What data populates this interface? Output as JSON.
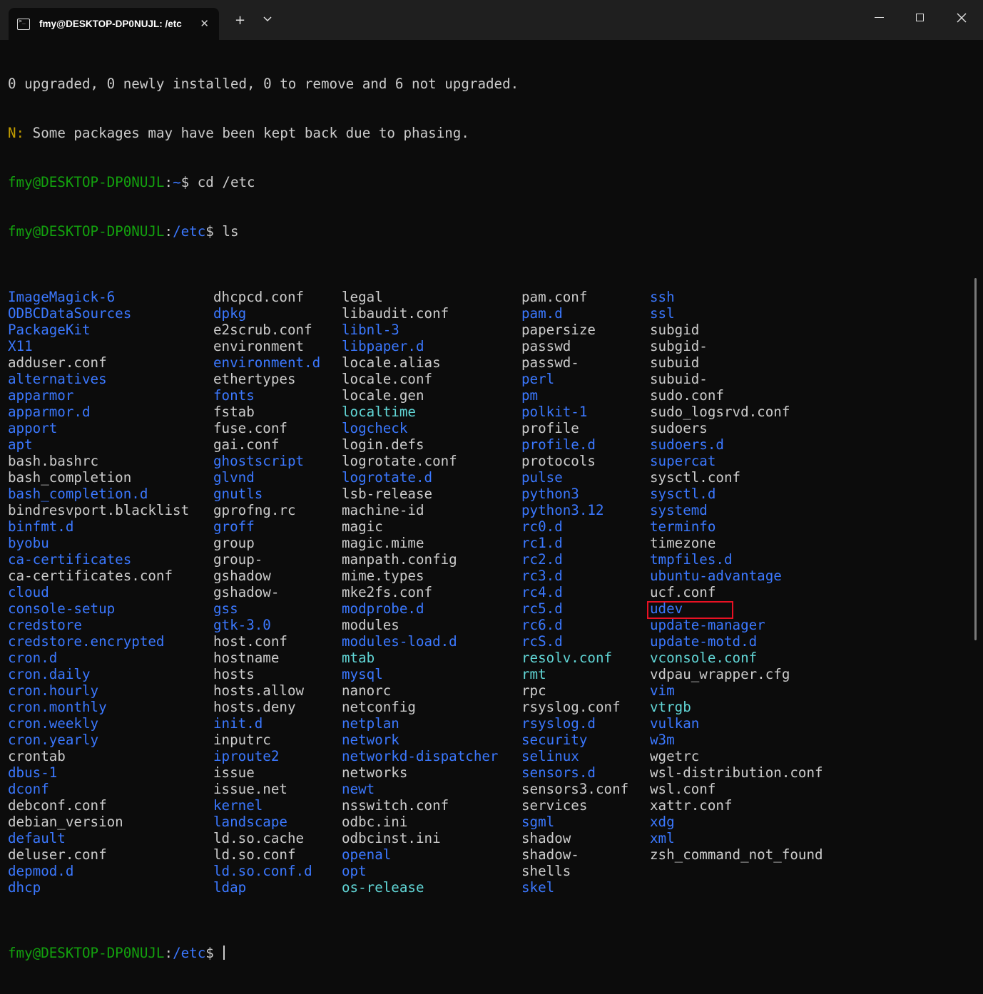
{
  "window": {
    "tab_title": "fmy@DESKTOP-DP0NUJL: /etc",
    "new_tab_label": "+"
  },
  "terminal": {
    "output_lines": [
      "0 upgraded, 0 newly installed, 0 to remove and 6 not upgraded."
    ],
    "notice": {
      "prefix": "N:",
      "text": " Some packages may have been kept back due to phasing."
    },
    "commands": [
      {
        "user": "fmy@DESKTOP-DP0NUJL",
        "sep": ":",
        "path": "~",
        "dollar": "$",
        "cmd": " cd /etc"
      },
      {
        "user": "fmy@DESKTOP-DP0NUJL",
        "sep": ":",
        "path": "/etc",
        "dollar": "$",
        "cmd": " ls"
      }
    ],
    "final_prompt": {
      "user": "fmy@DESKTOP-DP0NUJL",
      "sep": ":",
      "path": "/etc",
      "dollar": "$",
      "cmd": " "
    },
    "ls_columns": [
      [
        {
          "n": "ImageMagick-6",
          "t": "dir"
        },
        {
          "n": "ODBCDataSources",
          "t": "dir"
        },
        {
          "n": "PackageKit",
          "t": "dir"
        },
        {
          "n": "X11",
          "t": "dir"
        },
        {
          "n": "adduser.conf",
          "t": "file"
        },
        {
          "n": "alternatives",
          "t": "dir"
        },
        {
          "n": "apparmor",
          "t": "dir"
        },
        {
          "n": "apparmor.d",
          "t": "dir"
        },
        {
          "n": "apport",
          "t": "dir"
        },
        {
          "n": "apt",
          "t": "dir"
        },
        {
          "n": "bash.bashrc",
          "t": "file"
        },
        {
          "n": "bash_completion",
          "t": "file"
        },
        {
          "n": "bash_completion.d",
          "t": "dir"
        },
        {
          "n": "bindresvport.blacklist",
          "t": "file"
        },
        {
          "n": "binfmt.d",
          "t": "dir"
        },
        {
          "n": "byobu",
          "t": "dir"
        },
        {
          "n": "ca-certificates",
          "t": "dir"
        },
        {
          "n": "ca-certificates.conf",
          "t": "file"
        },
        {
          "n": "cloud",
          "t": "dir"
        },
        {
          "n": "console-setup",
          "t": "dir"
        },
        {
          "n": "credstore",
          "t": "dir"
        },
        {
          "n": "credstore.encrypted",
          "t": "dir"
        },
        {
          "n": "cron.d",
          "t": "dir"
        },
        {
          "n": "cron.daily",
          "t": "dir"
        },
        {
          "n": "cron.hourly",
          "t": "dir"
        },
        {
          "n": "cron.monthly",
          "t": "dir"
        },
        {
          "n": "cron.weekly",
          "t": "dir"
        },
        {
          "n": "cron.yearly",
          "t": "dir"
        },
        {
          "n": "crontab",
          "t": "file"
        },
        {
          "n": "dbus-1",
          "t": "dir"
        },
        {
          "n": "dconf",
          "t": "dir"
        },
        {
          "n": "debconf.conf",
          "t": "file"
        },
        {
          "n": "debian_version",
          "t": "file"
        },
        {
          "n": "default",
          "t": "dir"
        },
        {
          "n": "deluser.conf",
          "t": "file"
        },
        {
          "n": "depmod.d",
          "t": "dir"
        },
        {
          "n": "dhcp",
          "t": "dir"
        }
      ],
      [
        {
          "n": "dhcpcd.conf",
          "t": "file"
        },
        {
          "n": "dpkg",
          "t": "dir"
        },
        {
          "n": "e2scrub.conf",
          "t": "file"
        },
        {
          "n": "environment",
          "t": "file"
        },
        {
          "n": "environment.d",
          "t": "dir"
        },
        {
          "n": "ethertypes",
          "t": "file"
        },
        {
          "n": "fonts",
          "t": "dir"
        },
        {
          "n": "fstab",
          "t": "file"
        },
        {
          "n": "fuse.conf",
          "t": "file"
        },
        {
          "n": "gai.conf",
          "t": "file"
        },
        {
          "n": "ghostscript",
          "t": "dir"
        },
        {
          "n": "glvnd",
          "t": "dir"
        },
        {
          "n": "gnutls",
          "t": "dir"
        },
        {
          "n": "gprofng.rc",
          "t": "file"
        },
        {
          "n": "groff",
          "t": "dir"
        },
        {
          "n": "group",
          "t": "file"
        },
        {
          "n": "group-",
          "t": "file"
        },
        {
          "n": "gshadow",
          "t": "file"
        },
        {
          "n": "gshadow-",
          "t": "file"
        },
        {
          "n": "gss",
          "t": "dir"
        },
        {
          "n": "gtk-3.0",
          "t": "dir"
        },
        {
          "n": "host.conf",
          "t": "file"
        },
        {
          "n": "hostname",
          "t": "file"
        },
        {
          "n": "hosts",
          "t": "file"
        },
        {
          "n": "hosts.allow",
          "t": "file"
        },
        {
          "n": "hosts.deny",
          "t": "file"
        },
        {
          "n": "init.d",
          "t": "dir"
        },
        {
          "n": "inputrc",
          "t": "file"
        },
        {
          "n": "iproute2",
          "t": "dir"
        },
        {
          "n": "issue",
          "t": "file"
        },
        {
          "n": "issue.net",
          "t": "file"
        },
        {
          "n": "kernel",
          "t": "dir"
        },
        {
          "n": "landscape",
          "t": "dir"
        },
        {
          "n": "ld.so.cache",
          "t": "file"
        },
        {
          "n": "ld.so.conf",
          "t": "file"
        },
        {
          "n": "ld.so.conf.d",
          "t": "dir"
        },
        {
          "n": "ldap",
          "t": "dir"
        }
      ],
      [
        {
          "n": "legal",
          "t": "file"
        },
        {
          "n": "libaudit.conf",
          "t": "file"
        },
        {
          "n": "libnl-3",
          "t": "dir"
        },
        {
          "n": "libpaper.d",
          "t": "dir"
        },
        {
          "n": "locale.alias",
          "t": "file"
        },
        {
          "n": "locale.conf",
          "t": "file"
        },
        {
          "n": "locale.gen",
          "t": "file"
        },
        {
          "n": "localtime",
          "t": "link"
        },
        {
          "n": "logcheck",
          "t": "dir"
        },
        {
          "n": "login.defs",
          "t": "file"
        },
        {
          "n": "logrotate.conf",
          "t": "file"
        },
        {
          "n": "logrotate.d",
          "t": "dir"
        },
        {
          "n": "lsb-release",
          "t": "file"
        },
        {
          "n": "machine-id",
          "t": "file"
        },
        {
          "n": "magic",
          "t": "file"
        },
        {
          "n": "magic.mime",
          "t": "file"
        },
        {
          "n": "manpath.config",
          "t": "file"
        },
        {
          "n": "mime.types",
          "t": "file"
        },
        {
          "n": "mke2fs.conf",
          "t": "file"
        },
        {
          "n": "modprobe.d",
          "t": "dir"
        },
        {
          "n": "modules",
          "t": "file"
        },
        {
          "n": "modules-load.d",
          "t": "dir"
        },
        {
          "n": "mtab",
          "t": "link"
        },
        {
          "n": "mysql",
          "t": "dir"
        },
        {
          "n": "nanorc",
          "t": "file"
        },
        {
          "n": "netconfig",
          "t": "file"
        },
        {
          "n": "netplan",
          "t": "dir"
        },
        {
          "n": "network",
          "t": "dir"
        },
        {
          "n": "networkd-dispatcher",
          "t": "dir"
        },
        {
          "n": "networks",
          "t": "file"
        },
        {
          "n": "newt",
          "t": "dir"
        },
        {
          "n": "nsswitch.conf",
          "t": "file"
        },
        {
          "n": "odbc.ini",
          "t": "file"
        },
        {
          "n": "odbcinst.ini",
          "t": "file"
        },
        {
          "n": "openal",
          "t": "dir"
        },
        {
          "n": "opt",
          "t": "dir"
        },
        {
          "n": "os-release",
          "t": "link"
        }
      ],
      [
        {
          "n": "pam.conf",
          "t": "file"
        },
        {
          "n": "pam.d",
          "t": "dir"
        },
        {
          "n": "papersize",
          "t": "file"
        },
        {
          "n": "passwd",
          "t": "file"
        },
        {
          "n": "passwd-",
          "t": "file"
        },
        {
          "n": "perl",
          "t": "dir"
        },
        {
          "n": "pm",
          "t": "dir"
        },
        {
          "n": "polkit-1",
          "t": "dir"
        },
        {
          "n": "profile",
          "t": "file"
        },
        {
          "n": "profile.d",
          "t": "dir"
        },
        {
          "n": "protocols",
          "t": "file"
        },
        {
          "n": "pulse",
          "t": "dir"
        },
        {
          "n": "python3",
          "t": "dir"
        },
        {
          "n": "python3.12",
          "t": "dir"
        },
        {
          "n": "rc0.d",
          "t": "dir"
        },
        {
          "n": "rc1.d",
          "t": "dir"
        },
        {
          "n": "rc2.d",
          "t": "dir"
        },
        {
          "n": "rc3.d",
          "t": "dir"
        },
        {
          "n": "rc4.d",
          "t": "dir"
        },
        {
          "n": "rc5.d",
          "t": "dir"
        },
        {
          "n": "rc6.d",
          "t": "dir"
        },
        {
          "n": "rcS.d",
          "t": "dir"
        },
        {
          "n": "resolv.conf",
          "t": "link"
        },
        {
          "n": "rmt",
          "t": "link"
        },
        {
          "n": "rpc",
          "t": "file"
        },
        {
          "n": "rsyslog.conf",
          "t": "file"
        },
        {
          "n": "rsyslog.d",
          "t": "dir"
        },
        {
          "n": "security",
          "t": "dir"
        },
        {
          "n": "selinux",
          "t": "dir"
        },
        {
          "n": "sensors.d",
          "t": "dir"
        },
        {
          "n": "sensors3.conf",
          "t": "file"
        },
        {
          "n": "services",
          "t": "file"
        },
        {
          "n": "sgml",
          "t": "dir"
        },
        {
          "n": "shadow",
          "t": "file"
        },
        {
          "n": "shadow-",
          "t": "file"
        },
        {
          "n": "shells",
          "t": "file"
        },
        {
          "n": "skel",
          "t": "dir"
        }
      ],
      [
        {
          "n": "ssh",
          "t": "dir"
        },
        {
          "n": "ssl",
          "t": "dir"
        },
        {
          "n": "subgid",
          "t": "file"
        },
        {
          "n": "subgid-",
          "t": "file"
        },
        {
          "n": "subuid",
          "t": "file"
        },
        {
          "n": "subuid-",
          "t": "file"
        },
        {
          "n": "sudo.conf",
          "t": "file"
        },
        {
          "n": "sudo_logsrvd.conf",
          "t": "file"
        },
        {
          "n": "sudoers",
          "t": "file"
        },
        {
          "n": "sudoers.d",
          "t": "dir"
        },
        {
          "n": "supercat",
          "t": "dir"
        },
        {
          "n": "sysctl.conf",
          "t": "file"
        },
        {
          "n": "sysctl.d",
          "t": "dir"
        },
        {
          "n": "systemd",
          "t": "dir"
        },
        {
          "n": "terminfo",
          "t": "dir"
        },
        {
          "n": "timezone",
          "t": "file"
        },
        {
          "n": "tmpfiles.d",
          "t": "dir"
        },
        {
          "n": "ubuntu-advantage",
          "t": "dir"
        },
        {
          "n": "ucf.conf",
          "t": "file"
        },
        {
          "n": "udev",
          "t": "dir"
        },
        {
          "n": "update-manager",
          "t": "dir"
        },
        {
          "n": "update-motd.d",
          "t": "dir"
        },
        {
          "n": "vconsole.conf",
          "t": "link"
        },
        {
          "n": "vdpau_wrapper.cfg",
          "t": "file"
        },
        {
          "n": "vim",
          "t": "dir"
        },
        {
          "n": "vtrgb",
          "t": "link"
        },
        {
          "n": "vulkan",
          "t": "dir"
        },
        {
          "n": "w3m",
          "t": "dir"
        },
        {
          "n": "wgetrc",
          "t": "file"
        },
        {
          "n": "wsl-distribution.conf",
          "t": "file"
        },
        {
          "n": "wsl.conf",
          "t": "file"
        },
        {
          "n": "xattr.conf",
          "t": "file"
        },
        {
          "n": "xdg",
          "t": "dir"
        },
        {
          "n": "xml",
          "t": "dir"
        },
        {
          "n": "zsh_command_not_found",
          "t": "file"
        }
      ]
    ]
  },
  "colors": {
    "background": "#0c0c0c",
    "titlebar": "#1f1f1f",
    "text": "#cccccc",
    "user": "#13a10e",
    "path": "#3b78ff",
    "directory": "#3b78ff",
    "symlink": "#61d6d6",
    "warning": "#c19c00",
    "highlight_box": "#e81123"
  }
}
